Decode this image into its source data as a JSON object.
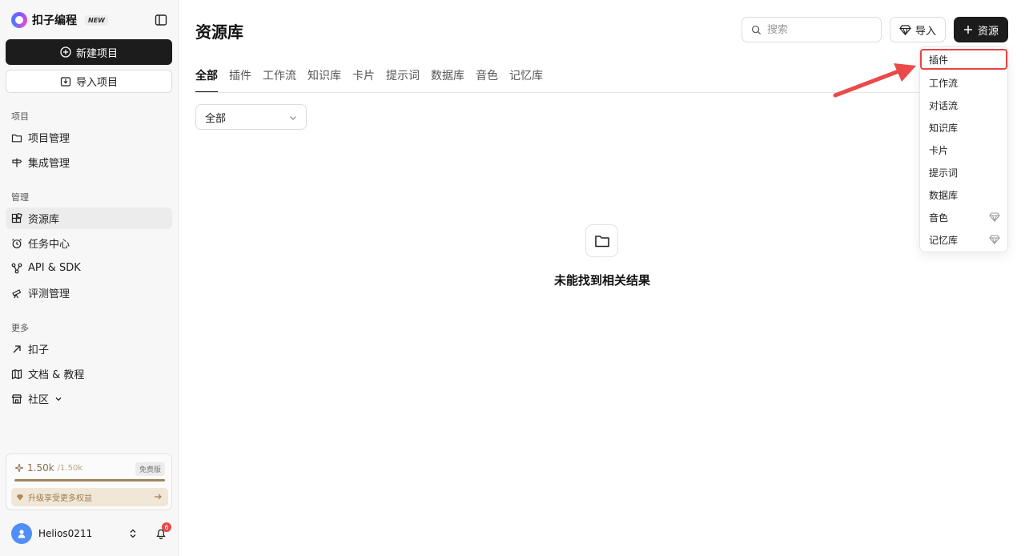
{
  "sidebar": {
    "brand": {
      "name": "扣子编程",
      "badge": "NEW"
    },
    "new_project": "新建项目",
    "import_project": "导入项目",
    "section_project": "项目",
    "project_items": [
      "项目管理",
      "集成管理"
    ],
    "section_manage": "管理",
    "manage_items": [
      "资源库",
      "任务中心",
      "API & SDK",
      "评测管理"
    ],
    "section_more": "更多",
    "more_items": [
      "扣子",
      "文档 & 教程",
      "社区"
    ],
    "credits": {
      "used": "1.50k",
      "total": "/1.50k",
      "plan": "免费版",
      "progress_fraction": 1.0,
      "upgrade": "升级享受更多权益"
    },
    "user": {
      "name": "Helios0211",
      "notifications": "6"
    }
  },
  "main": {
    "title": "资源库",
    "search_placeholder": "搜索",
    "import_label": "导入",
    "resource_label": "资源",
    "tabs": [
      "全部",
      "插件",
      "工作流",
      "知识库",
      "卡片",
      "提示词",
      "数据库",
      "音色",
      "记忆库"
    ],
    "filter_value": "全部",
    "empty_text": "未能找到相关结果"
  },
  "menu": {
    "items": [
      "插件",
      "工作流",
      "对话流",
      "知识库",
      "卡片",
      "提示词",
      "数据库",
      "音色",
      "记忆库"
    ],
    "premium": [
      "音色",
      "记忆库"
    ]
  },
  "colors": {
    "accent_dark": "#1c1c1c",
    "highlight_red": "#e84545",
    "credit_brown": "#a3835f"
  }
}
